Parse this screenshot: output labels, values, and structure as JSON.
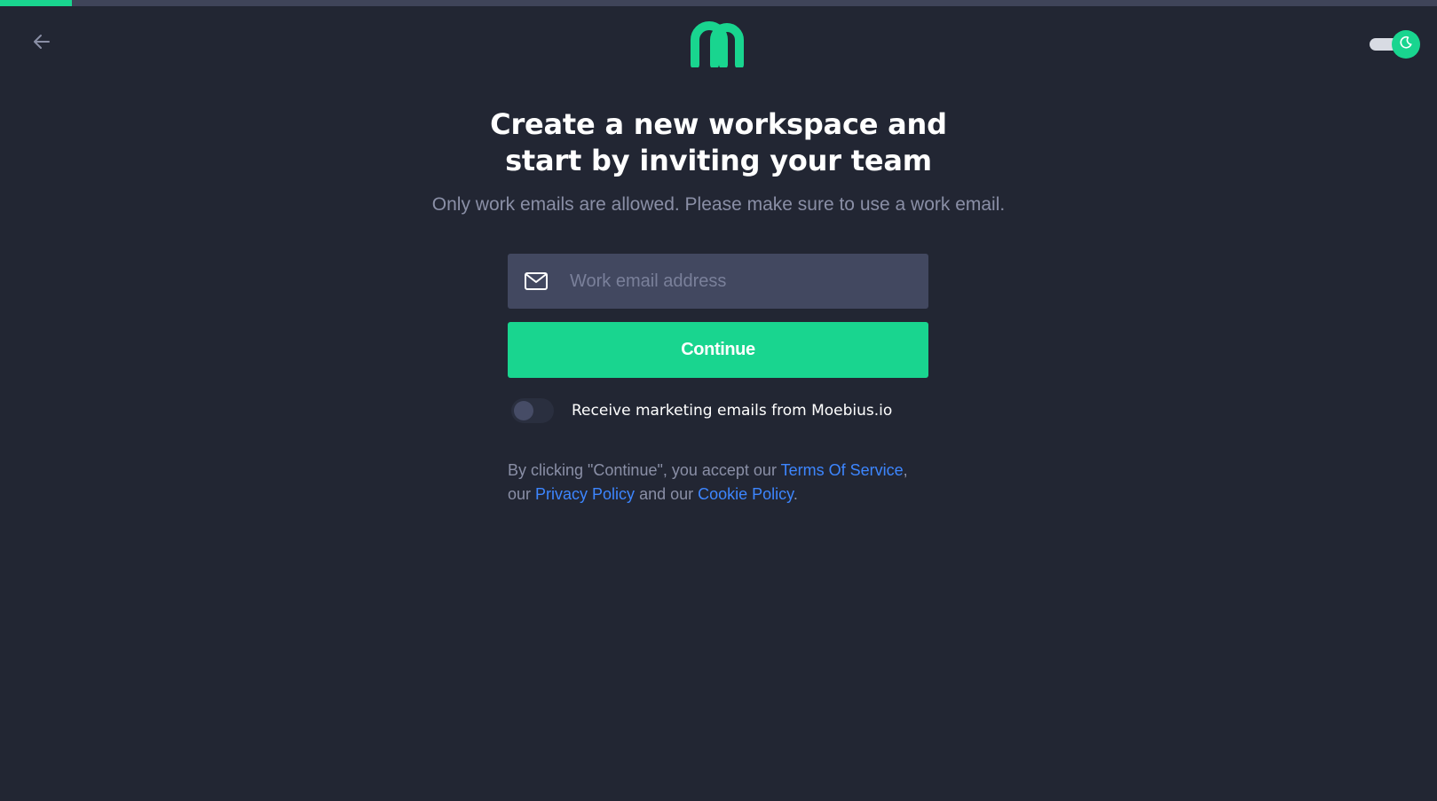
{
  "progress": {
    "fraction": 0.05,
    "color": "#19d58f"
  },
  "header": {
    "back_icon": "arrow-left-icon",
    "logo_icon": "moebius-logo-icon",
    "theme_toggle": {
      "state": "on",
      "icon": "moon-icon"
    }
  },
  "main": {
    "title_line1": "Create a new workspace and",
    "title_line2": "start by inviting your team",
    "subtitle": "Only work emails are allowed. Please make sure to use a work email.",
    "email": {
      "icon": "mail-icon",
      "placeholder": "Work email address",
      "value": ""
    },
    "continue_label": "Continue",
    "marketing": {
      "label": "Receive marketing emails from Moebius.io",
      "enabled": false
    },
    "legal": {
      "prefix": "By clicking \"Continue\", you accept our ",
      "terms": "Terms Of Service",
      "sep1": ", our ",
      "privacy": "Privacy Policy",
      "sep2": " and our ",
      "cookie": "Cookie Policy",
      "suffix": "."
    }
  },
  "colors": {
    "background": "#222633",
    "accent": "#19d58f",
    "link": "#3d86ff",
    "muted_text": "#8a8fa6",
    "field_bg": "#424860"
  }
}
